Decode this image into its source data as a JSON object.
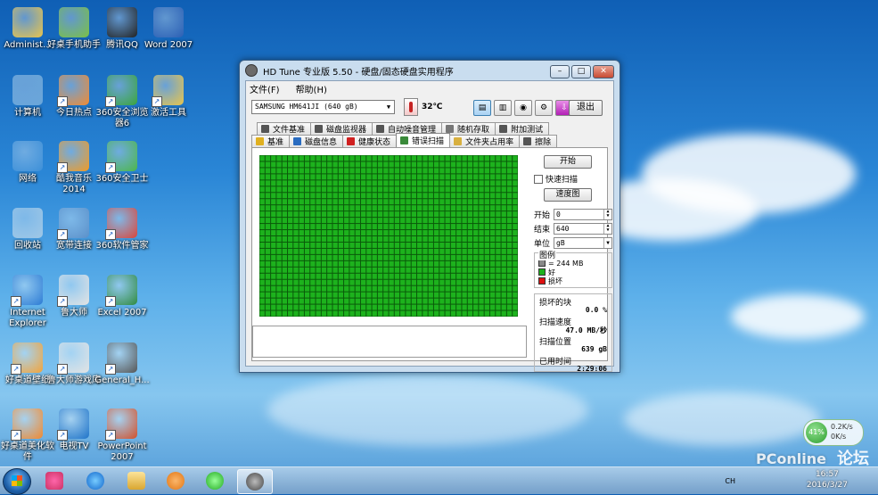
{
  "desktop": {
    "icons": [
      {
        "label": "Administ...",
        "color": "#e8c44b"
      },
      {
        "label": "好桌手机助手",
        "color": "#7bc043"
      },
      {
        "label": "腾讯QQ",
        "color": "#222222"
      },
      {
        "label": "Word 2007",
        "color": "#2b5fb4"
      },
      {
        "label": "计算机",
        "color": "#6aa6d9"
      },
      {
        "label": "今日热点",
        "color": "#f28a30"
      },
      {
        "label": "360安全浏览器6",
        "color": "#3aa43a"
      },
      {
        "label": "激活工具",
        "color": "#e8c44b"
      },
      {
        "label": "网络",
        "color": "#3c8fd8"
      },
      {
        "label": "酷我音乐2014",
        "color": "#f39a21"
      },
      {
        "label": "360安全卫士",
        "color": "#4cb648"
      },
      {
        "label": "回收站",
        "color": "#9fc7e6"
      },
      {
        "label": "宽带连接",
        "color": "#5a8fc9"
      },
      {
        "label": "360软件管家",
        "color": "#d9453a"
      },
      {
        "label": "Internet Explorer",
        "color": "#2c7bd4"
      },
      {
        "label": "鲁大师",
        "color": "#e3e3e3"
      },
      {
        "label": "Excel 2007",
        "color": "#2f8a3f"
      },
      {
        "label": "好桌道壁纸",
        "color": "#f2a33a"
      },
      {
        "label": "鲁大师游戏库",
        "color": "#e3e3e3"
      },
      {
        "label": "General_H...",
        "color": "#555555"
      },
      {
        "label": "好桌道美化软件",
        "color": "#f28a30"
      },
      {
        "label": "电视TV",
        "color": "#1f74c9"
      },
      {
        "label": "PowerPoint 2007",
        "color": "#d2512b"
      }
    ]
  },
  "window": {
    "title": "HD Tune 专业版 5.50 - 硬盘/固态硬盘实用程序",
    "controls": {
      "minimize": "–",
      "maximize": "□",
      "close": "✕"
    },
    "menu": [
      "文件(F)",
      "帮助(H)"
    ],
    "drive": "SAMSUNG HM641JI (640 gB)",
    "temperature": "32℃",
    "exit_label": "退出",
    "tabs_row1": [
      {
        "label": "文件基准",
        "icon": "file-benchmark-icon",
        "color": "#555555"
      },
      {
        "label": "磁盘监视器",
        "icon": "disk-monitor-icon",
        "color": "#555555"
      },
      {
        "label": "自动噪音管理",
        "icon": "speaker-icon",
        "color": "#555555"
      },
      {
        "label": "随机存取",
        "icon": "random-access-icon",
        "color": "#777777"
      },
      {
        "label": "附加测试",
        "icon": "extra-tests-icon",
        "color": "#555555"
      }
    ],
    "tabs_row2": [
      {
        "label": "基准",
        "icon": "benchmark-icon",
        "color": "#e0b020"
      },
      {
        "label": "磁盘信息",
        "icon": "info-icon",
        "color": "#2a6cc0"
      },
      {
        "label": "健康状态",
        "icon": "health-icon",
        "color": "#d02020"
      },
      {
        "label": "错误扫描",
        "icon": "magnifier-icon",
        "color": "#3a8a3a",
        "active": true
      },
      {
        "label": "文件夹占用率",
        "icon": "folder-icon",
        "color": "#d8b040"
      },
      {
        "label": "擦除",
        "icon": "erase-icon",
        "color": "#555555"
      }
    ],
    "scan": {
      "start_button": "开始",
      "quick_scan_label": "快速扫描",
      "speed_map_button": "速度图",
      "start_label": "开始",
      "start_value": "0",
      "end_label": "结束",
      "end_value": "640",
      "unit_label": "单位",
      "unit_value": "gB",
      "legend_title": "图例",
      "legend_block": "= 244 MB",
      "legend_good": "好",
      "legend_bad": "损坏",
      "damaged_blocks_label": "损坏的块",
      "damaged_blocks_value": "0.0 %",
      "scan_speed_label": "扫描速度",
      "scan_speed_value": "47.0 MB/秒",
      "scan_position_label": "扫描位置",
      "scan_position_value": "639 gB",
      "elapsed_label": "已用时间",
      "elapsed_value": "2:29:06",
      "grid_cols": 46,
      "grid_rows": 26,
      "good_color": "#1db21d",
      "line_color": "#0a5a0a"
    }
  },
  "taskbar": {
    "tray_lang": "CH",
    "time": "16:57",
    "date": "2016/3/27",
    "net_percent": "41%",
    "up_speed": "0.2K/s",
    "down_speed": "0K/s"
  },
  "watermark": {
    "brand": "PConline",
    "sub": "论坛"
  }
}
